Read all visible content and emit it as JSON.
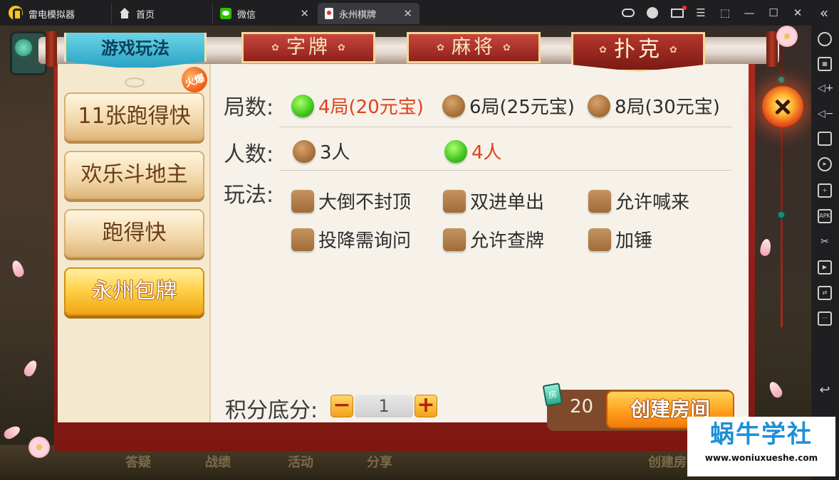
{
  "emulator": {
    "app_name": "雷电模拟器",
    "tabs": [
      {
        "label": "首页",
        "icon": "home-icon"
      },
      {
        "label": "微信",
        "icon": "wechat-icon"
      },
      {
        "label": "永州棋牌",
        "icon": "game-icon",
        "active": true
      }
    ],
    "window_controls": {
      "minimize": "—",
      "maximize": "☐",
      "close": "✕",
      "collapse": "«"
    },
    "sidebar_icons": [
      "settings-icon",
      "keyboard-icon",
      "volume-up-icon",
      "volume-down-icon",
      "screenshot-icon",
      "rotate-icon",
      "add-app-icon",
      "apk-install-icon",
      "scissors-icon",
      "video-record-icon",
      "sync-icon",
      "more-icon",
      "back-icon"
    ],
    "sidebar_apk_label": "APK"
  },
  "dialog": {
    "title": "游戏玩法",
    "category_tabs": [
      {
        "label": "字牌",
        "active": false
      },
      {
        "label": "麻将",
        "active": false
      },
      {
        "label": "扑克",
        "active": true
      }
    ],
    "modes": [
      {
        "label": "11张跑得快",
        "badge": "火爆",
        "selected": false
      },
      {
        "label": "欢乐斗地主",
        "selected": false
      },
      {
        "label": "跑得快",
        "selected": false
      },
      {
        "label": "永州包牌",
        "selected": true
      }
    ],
    "rounds": {
      "label": "局数:",
      "options": [
        {
          "label": "4局(20元宝)",
          "selected": true
        },
        {
          "label": "6局(25元宝)",
          "selected": false
        },
        {
          "label": "8局(30元宝)",
          "selected": false
        }
      ]
    },
    "players": {
      "label": "人数:",
      "options": [
        {
          "label": "3人",
          "selected": false
        },
        {
          "label": "4人",
          "selected": true
        }
      ]
    },
    "rules": {
      "label": "玩法:",
      "options": [
        {
          "label": "大倒不封顶",
          "checked": false
        },
        {
          "label": "双进单出",
          "checked": false
        },
        {
          "label": "允许喊来",
          "checked": false
        },
        {
          "label": "投降需询问",
          "checked": false
        },
        {
          "label": "允许查牌",
          "checked": false
        },
        {
          "label": "加锤",
          "checked": false
        }
      ]
    },
    "score": {
      "label": "积分底分:",
      "value": "1",
      "minus": "−",
      "plus": "+"
    },
    "room_cost": {
      "card_label": "房",
      "value": "20"
    },
    "create_button": "创建房间"
  },
  "background": {
    "bottom_items": [
      "答疑",
      "战绩",
      "活动",
      "分享",
      "创建房"
    ]
  },
  "watermark": {
    "title": "蜗牛学社",
    "url": "www.woniuxueshe.com"
  },
  "colors": {
    "accent_red": "#e0401b",
    "selected_green": "#3fc61a",
    "tab_red": "#a9281f",
    "watermark_blue": "#1c8fd6"
  }
}
